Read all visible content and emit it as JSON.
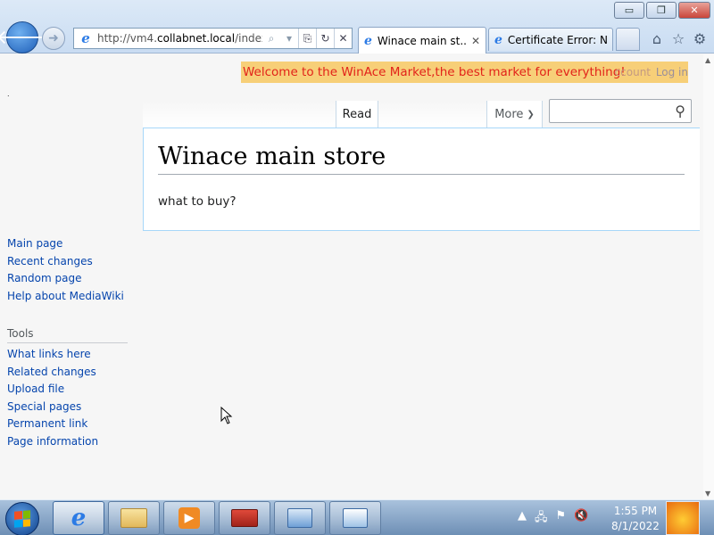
{
  "browser": {
    "address_url_prefix": "http://vm4.",
    "address_url_host": "collabnet.local",
    "address_url_suffix": "/index.p",
    "tabs": [
      {
        "title": "Winace main st...",
        "active": true
      },
      {
        "title": "Certificate Error: N...",
        "active": false
      }
    ],
    "window_buttons": {
      "minimize": "▭",
      "restore": "❐",
      "close": "✕"
    }
  },
  "page": {
    "banner_message": "Welcome to the WinAce Market,the best market for everything!",
    "banner_create_account": "ccount",
    "banner_login": "Log in",
    "dot": ".",
    "tabs": {
      "read": "Read",
      "more": "More"
    },
    "title": "Winace main store",
    "lead": "what to buy?"
  },
  "sidebar": {
    "navigation": [
      "Main page",
      "Recent changes",
      "Random page",
      "Help about MediaWiki"
    ],
    "tools_heading": "Tools",
    "tools": [
      "What links here",
      "Related changes",
      "Upload file",
      "Special pages",
      "Permanent link",
      "Page information"
    ]
  },
  "taskbar": {
    "time": "1:55 PM",
    "date": "8/1/2022"
  },
  "colors": {
    "banner_bg": "#f7cf78",
    "banner_text": "#e2231a",
    "link": "#0645ad"
  }
}
